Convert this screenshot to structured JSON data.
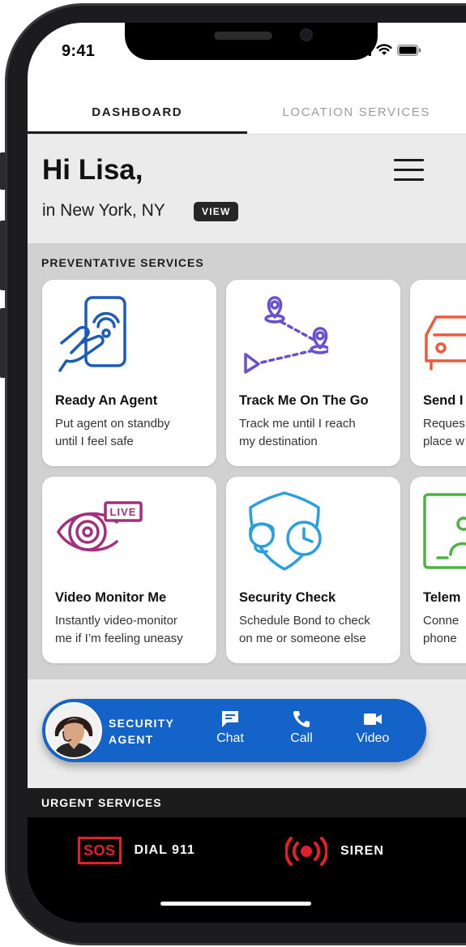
{
  "status_bar": {
    "time": "9:41"
  },
  "tabs": [
    {
      "label": "DASHBOARD",
      "active": true
    },
    {
      "label": "LOCATION SERVICES",
      "active": false
    }
  ],
  "greeting": {
    "title": "Hi Lisa,",
    "location": "in New York, NY",
    "view_label": "VIEW"
  },
  "preventative": {
    "title": "PREVENTATIVE SERVICES",
    "cards": [
      {
        "title": "Ready An Agent",
        "desc": "Put agent on standby\nuntil I feel safe",
        "icon": "hand-phone-nfc-icon"
      },
      {
        "title": "Track Me On The Go",
        "desc": "Track me until I reach\nmy destination",
        "icon": "route-tracking-icon"
      },
      {
        "title": "Send I",
        "desc": "Reques\nplace w",
        "icon": "car-icon"
      },
      {
        "title": "Video Monitor Me",
        "desc": "Instantly video-monitor\nme if I’m feeling uneasy",
        "icon": "eye-live-icon"
      },
      {
        "title": "Security Check",
        "desc": "Schedule Bond to check\non me or someone else",
        "icon": "shield-clock-icon"
      },
      {
        "title": "Telem",
        "desc": "Conne\nphone",
        "icon": "telemedicine-icon"
      }
    ]
  },
  "agent": {
    "label_line1": "SECURITY",
    "label_line2": "AGENT",
    "actions": [
      {
        "label": "Chat",
        "icon": "chat-icon"
      },
      {
        "label": "Call",
        "icon": "phone-icon"
      },
      {
        "label": "Video",
        "icon": "video-camera-icon"
      }
    ]
  },
  "urgent": {
    "title_prefix": "URGENT ",
    "title_bold": "SERVICES",
    "dial_badge": "SOS",
    "dial_label": "DIAL 911",
    "siren_label": "SIREN"
  },
  "colors": {
    "accent_blue": "#1463c8",
    "icon_blue": "#1c5bb8",
    "icon_purple": "#6a4fcf",
    "icon_orange": "#ef5a3c",
    "icon_magenta": "#a2307e",
    "icon_cyan": "#2a9fe0",
    "icon_green": "#4cb240",
    "alert_red": "#e0202a"
  }
}
